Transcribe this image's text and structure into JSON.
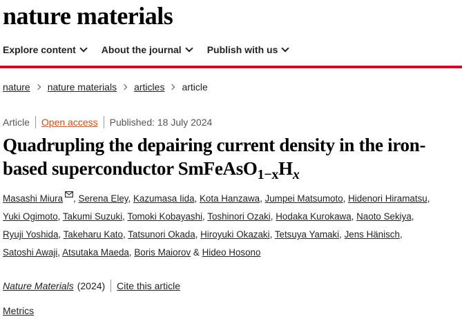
{
  "site": {
    "logo_text": "nature materials"
  },
  "nav": {
    "items": [
      {
        "label": "Explore content"
      },
      {
        "label": "About the journal"
      },
      {
        "label": "Publish with us"
      }
    ]
  },
  "breadcrumb": [
    "nature",
    "nature materials",
    "articles",
    "article"
  ],
  "meta": {
    "type": "Article",
    "access": "Open access",
    "published": "Published: 18 July 2024"
  },
  "title": {
    "part1": "Quadrupling the depairing current density in the iron-based superconductor SmFeAsO",
    "sub": "1−x",
    "h": "H",
    "x": "x"
  },
  "authors": [
    "Masashi Miura",
    "Serena Eley",
    "Kazumasa Iida",
    "Kota Hanzawa",
    "Jumpei Matsumoto",
    "Hidenori Hiramatsu",
    "Yuki Ogimoto",
    "Takumi Suzuki",
    "Tomoki Kobayashi",
    "Toshinori Ozaki",
    "Hodaka Kurokawa",
    "Naoto Sekiya",
    "Ryuji Yoshida",
    "Takeharu Kato",
    "Tatsunori Okada",
    "Hiroyuki Okazaki",
    "Tetsuya Yamaki",
    "Jens Hänisch",
    "Satoshi Awaji",
    "Atsutaka Maeda",
    "Boris Maiorov",
    "Hideo Hosono"
  ],
  "author_separator": ", ",
  "author_last_joiner": " & ",
  "citation": {
    "journal": "Nature Materials",
    "year": "(2024)",
    "cite_label": "Cite this article"
  },
  "metrics_label": "Metrics"
}
